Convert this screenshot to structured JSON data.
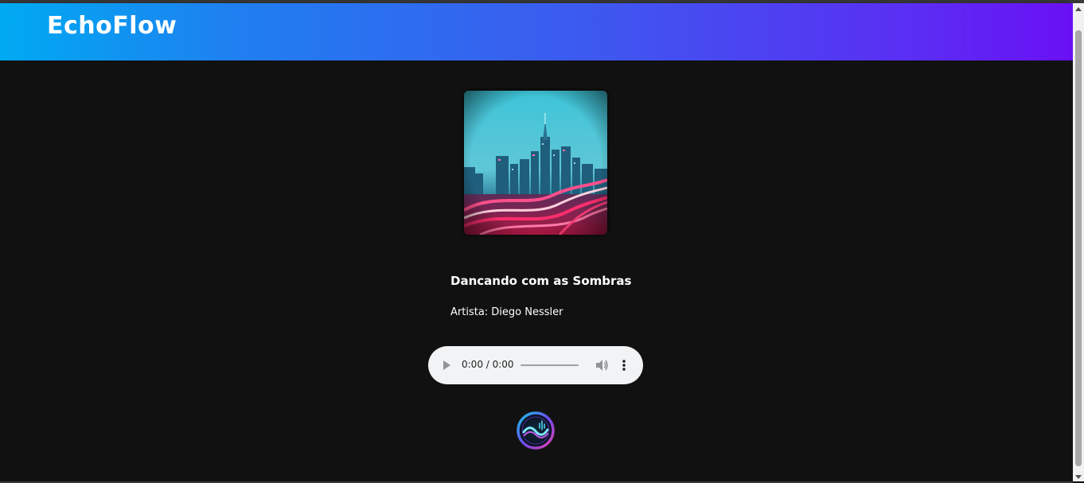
{
  "header": {
    "brand": "EchoFlow"
  },
  "track": {
    "cover_alt": "album-cover",
    "title": "Dancando com as Sombras",
    "artist": "Artista: Diego Nessler"
  },
  "player": {
    "time": "0:00 / 0:00",
    "progress": 0,
    "play_icon": "play-icon",
    "volume_icon": "volume-icon",
    "menu_icon": "more-vert-icon"
  },
  "footer": {
    "logo_icon": "soundwave-logo-icon"
  },
  "colors": {
    "header_start": "#00aaf2",
    "header_end": "#6a10f4",
    "background": "#111111",
    "player_bg": "#f1f3f4",
    "text": "#ffffff"
  }
}
